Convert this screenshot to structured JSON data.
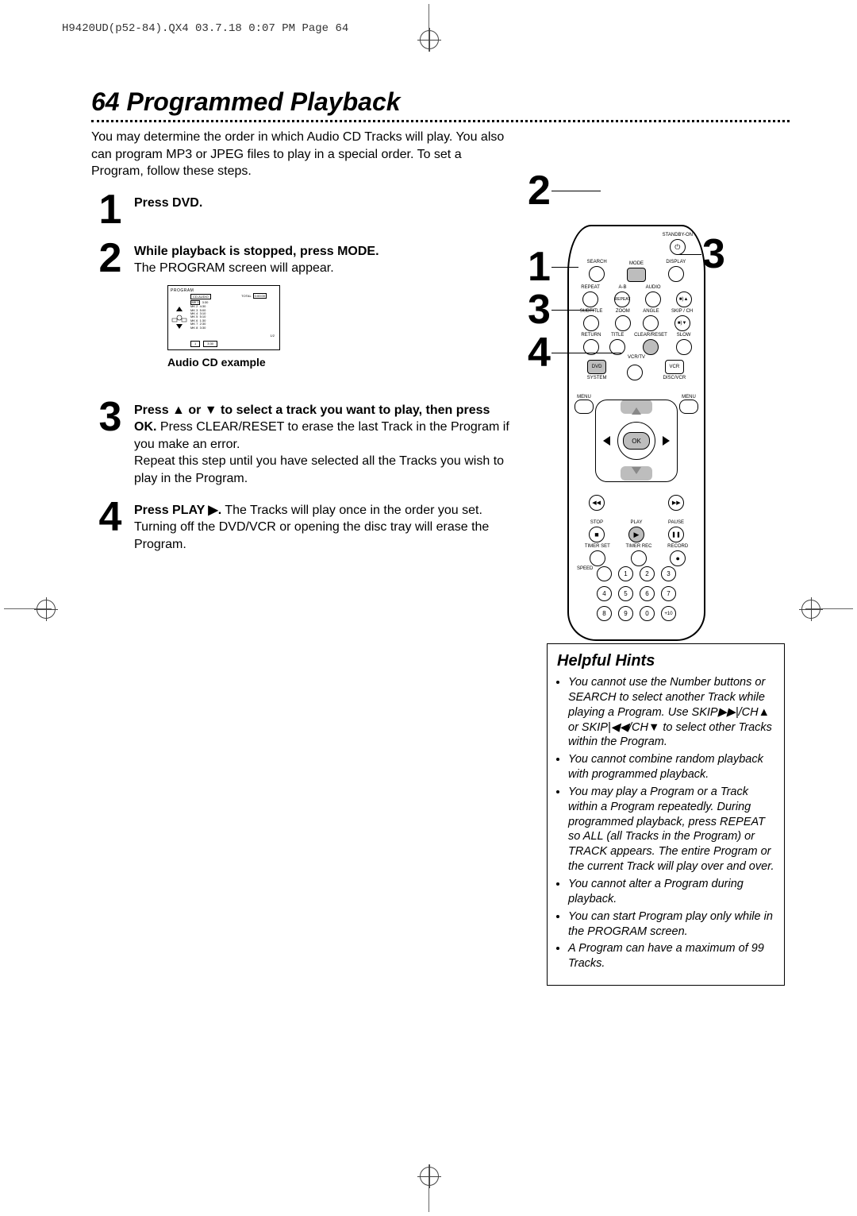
{
  "print_header": "H9420UD(p52-84).QX4  03.7.18  0:07 PM  Page 64",
  "page": {
    "number": "64",
    "title": "Programmed Playback"
  },
  "intro": "You may determine the order in which Audio CD Tracks will play. You also can program MP3 or JPEG files to play in a special order. To set a Program, follow these steps.",
  "steps": {
    "s1": {
      "n": "1",
      "b1": "Press DVD."
    },
    "s2": {
      "n": "2",
      "b1": "While playback is stopped, press MODE.",
      "t1": "The PROGRAM screen will appear."
    },
    "s3": {
      "n": "3",
      "b1": "Press ▲ or ▼ to select a track you want to play, then press OK.",
      "t1": " Press CLEAR/RESET to erase the last Track in the Program if you make an error.",
      "t2": "Repeat this step until you have selected all the Tracks you wish to play in the Program."
    },
    "s4": {
      "n": "4",
      "b1": "Press PLAY ▶.",
      "t1": " The Tracks will play once in the order you set. Turning off the DVD/VCR or opening the disc tray will erase the Program."
    }
  },
  "cd_example": {
    "label_program": "PROGRAM",
    "label_cd_audio": "CD-AUDIO",
    "label_total": "TOTAL",
    "total_time": "0:00:00",
    "tracks": [
      {
        "n": "MK 1",
        "t": "3:30"
      },
      {
        "n": "MK 2",
        "t": "4:30"
      },
      {
        "n": "MK 3",
        "t": "5:00"
      },
      {
        "n": "MK 4",
        "t": "3:10"
      },
      {
        "n": "MK 5",
        "t": "5:10"
      },
      {
        "n": "MK 6",
        "t": "1:30"
      },
      {
        "n": "MK 7",
        "t": "2:30"
      },
      {
        "n": "MK 8",
        "t": "3:30"
      }
    ],
    "page_indicator": "1/2",
    "bottom_num": "1",
    "bottom_time": "3:30",
    "caption": "Audio CD example"
  },
  "remote": {
    "standby": "STANDBY-ON",
    "row1": [
      "SEARCH",
      "MODE",
      "DISPLAY"
    ],
    "row2": [
      "REPEAT",
      "A-B",
      "REPEAT",
      "AUDIO",
      "■)▲"
    ],
    "row3": [
      "SUBTITLE",
      "ZOOM",
      "ANGLE",
      "SKIP / CH",
      "■)▼"
    ],
    "row4": [
      "RETURN",
      "TITLE",
      "CLEAR/RESET",
      "SLOW"
    ],
    "row5_top": "VCR/TV",
    "row5_left": "DVD",
    "row5_right": "VCR",
    "row6_left": "SYSTEM",
    "row6_right": "DISC/VCR",
    "menu": "MENU",
    "ok": "OK",
    "r7": [
      "◀◀",
      "▼",
      "▶▶"
    ],
    "r8_labels": [
      "STOP",
      "PLAY",
      "PAUSE"
    ],
    "r8_icons": [
      "■",
      "▶",
      "❚❚"
    ],
    "r9_labels_top": [
      "TIMER SET",
      "TIMER REC",
      "RECORD"
    ],
    "r9_icons": [
      "",
      "",
      "●"
    ],
    "speed": "SPEED",
    "nums": [
      "1",
      "2",
      "3",
      "4",
      "5",
      "6",
      "7",
      "8",
      "9",
      "0",
      "+10"
    ]
  },
  "callouts": {
    "c1": "1",
    "c2": "2",
    "c3a": "3",
    "c3b": "3",
    "c4": "4"
  },
  "hints": {
    "title": "Helpful Hints",
    "items": [
      "You cannot use the Number buttons or SEARCH to select another Track while playing a Program. Use SKIP▶▶|/CH▲ or SKIP|◀◀/CH▼ to select other Tracks within the Program.",
      "You cannot combine random playback with programmed playback.",
      "You may play a Program or a Track within a Program repeatedly. During programmed playback, press REPEAT so ALL (all Tracks in the Program) or TRACK appears. The entire Program or the current Track will play over and over.",
      "You cannot alter a Program during playback.",
      "You can start Program play only while in the PROGRAM screen.",
      "A Program can have a maximum of 99 Tracks."
    ]
  }
}
